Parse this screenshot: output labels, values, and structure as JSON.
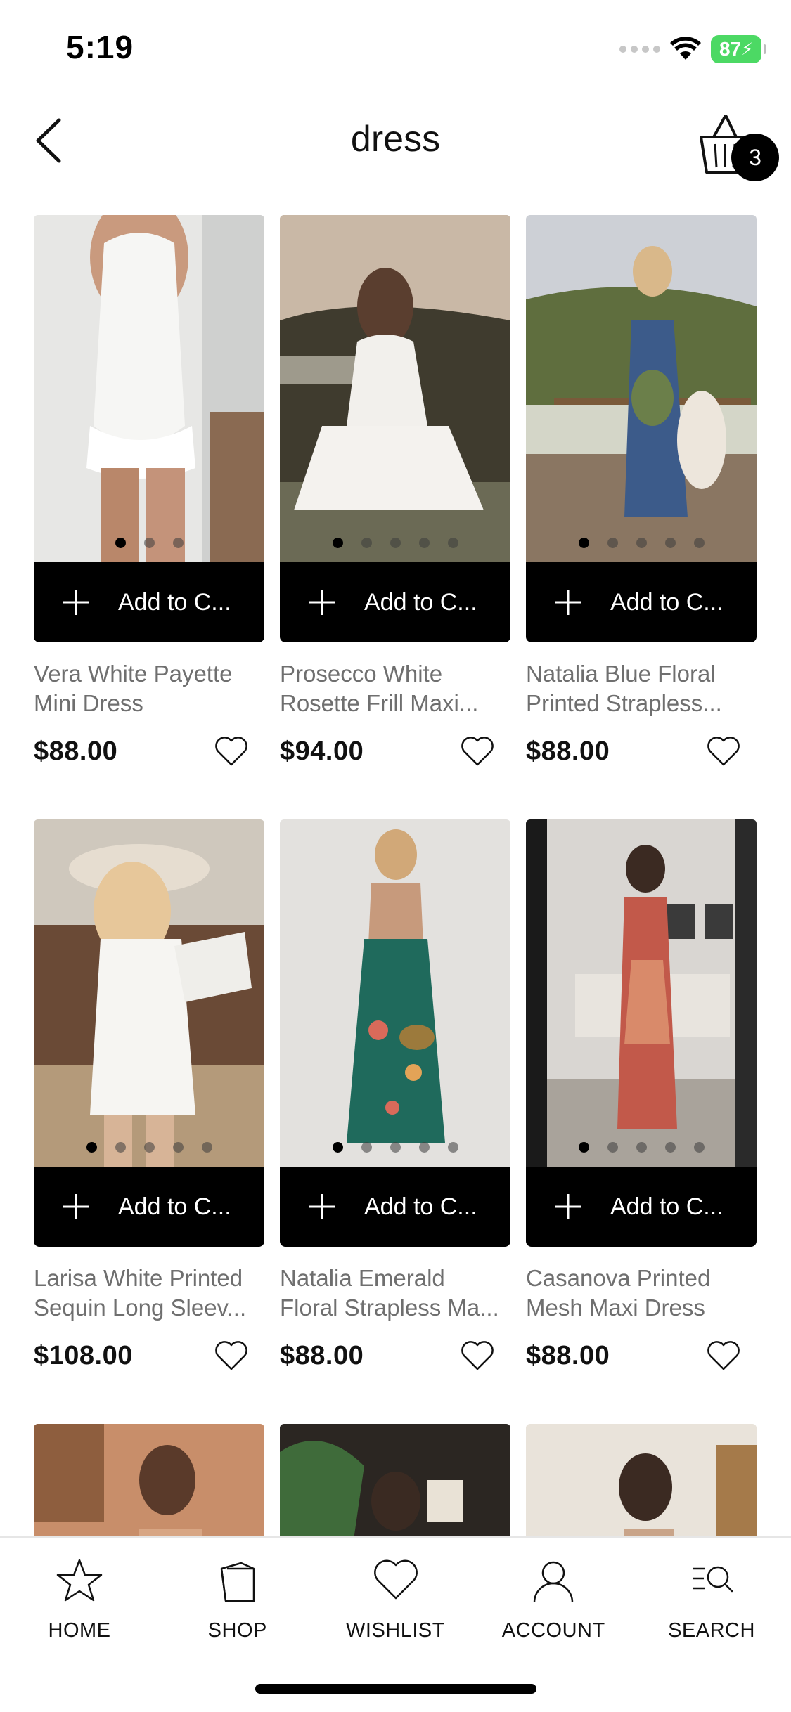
{
  "status_bar": {
    "time": "5:19",
    "battery": "87"
  },
  "header": {
    "title": "dress",
    "cart_count": "3"
  },
  "products": [
    {
      "name_line1": "Vera White Payette",
      "name_line2": "Mini Dress",
      "price": "$88.00",
      "add_label": "Add to C...",
      "dots": 3,
      "active_dot": 0
    },
    {
      "name_line1": "Prosecco White",
      "name_line2": "Rosette Frill Maxi...",
      "price": "$94.00",
      "add_label": "Add to C...",
      "dots": 5,
      "active_dot": 0
    },
    {
      "name_line1": "Natalia Blue Floral",
      "name_line2": "Printed Strapless...",
      "price": "$88.00",
      "add_label": "Add to C...",
      "dots": 5,
      "active_dot": 0
    },
    {
      "name_line1": "Larisa White Printed",
      "name_line2": "Sequin Long Sleev...",
      "price": "$108.00",
      "add_label": "Add to C...",
      "dots": 5,
      "active_dot": 0
    },
    {
      "name_line1": "Natalia Emerald",
      "name_line2": "Floral Strapless Ma...",
      "price": "$88.00",
      "add_label": "Add to C...",
      "dots": 5,
      "active_dot": 0
    },
    {
      "name_line1": "Casanova Printed",
      "name_line2": "Mesh Maxi Dress",
      "price": "$88.00",
      "add_label": "Add to C...",
      "dots": 5,
      "active_dot": 0
    }
  ],
  "nav": {
    "home": "HOME",
    "shop": "SHOP",
    "wishlist": "WISHLIST",
    "account": "ACCOUNT",
    "search": "SEARCH"
  }
}
